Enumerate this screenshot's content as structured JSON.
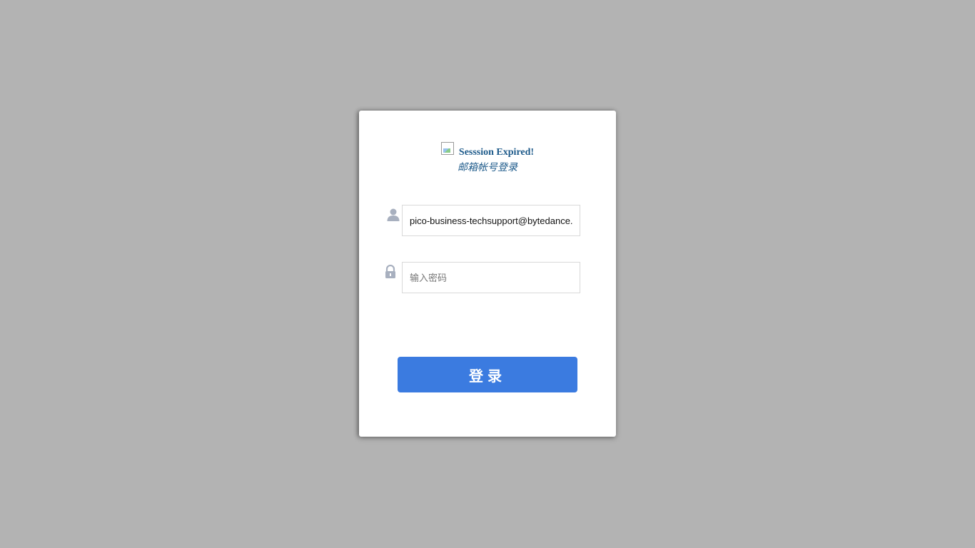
{
  "login": {
    "title": "Sesssion Expired!",
    "subtitle": "邮箱帐号登录",
    "email_value": "pico-business-techsupport@bytedance.com",
    "password_value": "",
    "password_placeholder": "输入密码",
    "submit_label": "登录"
  },
  "icons": {
    "logo": "broken-image-icon",
    "user": "user-icon",
    "password": "lock-icon"
  },
  "colors": {
    "backdrop": "#b3b3b3",
    "title": "#1d5a8a",
    "button": "#3b7be0",
    "icon": "#a8b0bf"
  }
}
